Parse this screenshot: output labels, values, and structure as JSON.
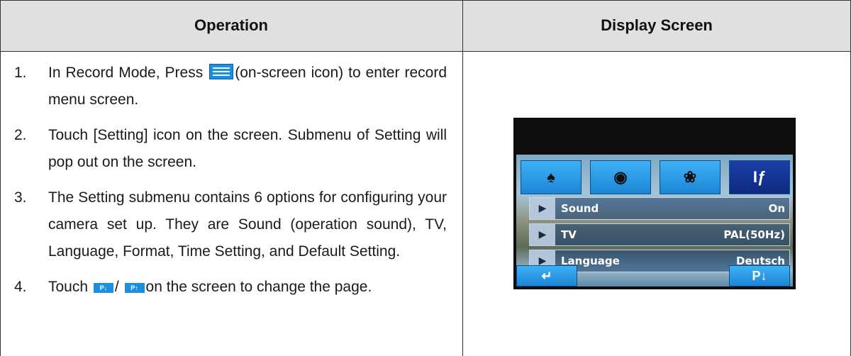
{
  "header": {
    "operation": "Operation",
    "display_screen": "Display Screen"
  },
  "steps": [
    {
      "num": "1.",
      "before": "In Record Mode, Press ",
      "after": "(on-screen icon) to enter record menu screen."
    },
    {
      "num": "2.",
      "text": "Touch [Setting] icon on the screen. Submenu of Setting will pop out on the screen."
    },
    {
      "num": "3.",
      "text": "The Setting submenu contains 6 options for configuring your camera set up. They are Sound (operation sound), TV, Language, Format, Time Setting, and Default Setting."
    },
    {
      "num": "4.",
      "before": "Touch ",
      "sep": "/ ",
      "after": "on the screen to change the page.",
      "page_down": "P↓",
      "page_up": "P↑"
    }
  ],
  "device": {
    "tabs": [
      {
        "icon": "scene-icon",
        "glyph": "♠"
      },
      {
        "icon": "camera-icon",
        "glyph": "◉"
      },
      {
        "icon": "effect-icon",
        "glyph": "❀"
      },
      {
        "icon": "setting-icon",
        "glyph": "Iƒ"
      }
    ],
    "rows": [
      {
        "label": "Sound",
        "value": "On"
      },
      {
        "label": "TV",
        "value": "PAL(50Hz)"
      },
      {
        "label": "Language",
        "value": "Deutsch"
      }
    ],
    "back_glyph": "↵",
    "page_down": "P↓"
  },
  "colors": {
    "header_bg": "#e0e0e0",
    "accent": "#1b8fe0"
  }
}
